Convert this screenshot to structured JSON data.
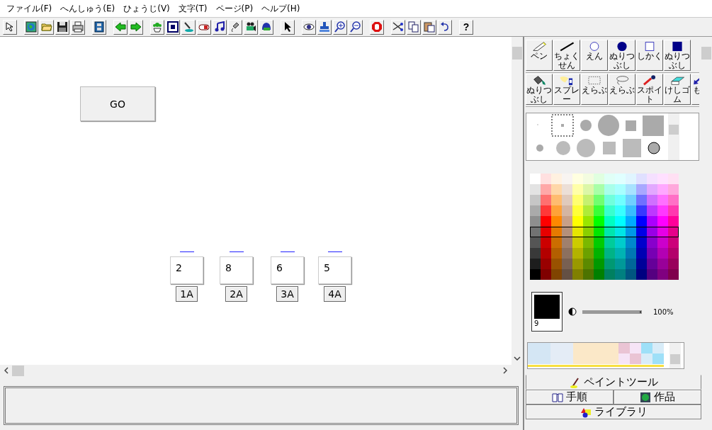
{
  "menu": [
    "ファイル(F)",
    "へんしゅう(E)",
    "ひょうじ(V)",
    "文字(T)",
    "ページ(P)",
    "ヘルプ(H)"
  ],
  "toolbar": [
    [
      {
        "kind": "pointer"
      }
    ],
    [
      {
        "kind": "globe"
      },
      {
        "kind": "folder"
      },
      {
        "kind": "floppy"
      },
      {
        "kind": "printer"
      }
    ],
    [
      {
        "kind": "film"
      }
    ],
    [
      {
        "kind": "arrow-left"
      },
      {
        "kind": "arrow-right"
      }
    ],
    [
      {
        "kind": "plant"
      },
      {
        "kind": "text-box"
      },
      {
        "kind": "brush"
      },
      {
        "kind": "capsule"
      },
      {
        "kind": "note"
      },
      {
        "kind": "mic"
      },
      {
        "kind": "camera"
      },
      {
        "kind": "helmet"
      }
    ],
    [
      {
        "kind": "cursor"
      }
    ],
    [
      {
        "kind": "eye"
      },
      {
        "kind": "stamp"
      },
      {
        "kind": "zoom-in"
      },
      {
        "kind": "zoom-out"
      }
    ],
    [
      {
        "kind": "stop"
      }
    ],
    [
      {
        "kind": "scissors"
      },
      {
        "kind": "copy"
      },
      {
        "kind": "paste"
      },
      {
        "kind": "undo"
      }
    ],
    [
      {
        "kind": "text",
        "text": "?"
      }
    ]
  ],
  "canvas": {
    "go_button": "GO",
    "cards": [
      {
        "value": "2",
        "label": "1A"
      },
      {
        "value": "8",
        "label": "2A"
      },
      {
        "value": "6",
        "label": "3A"
      },
      {
        "value": "5",
        "label": "4A"
      }
    ]
  },
  "paint_tools": [
    [
      {
        "kind": "pen",
        "label": "ペン"
      },
      {
        "kind": "line",
        "label": "ちょくせん"
      },
      {
        "kind": "circle",
        "label": "えん"
      },
      {
        "kind": "filled-circle",
        "label": "ぬりつぶし"
      },
      {
        "kind": "rect",
        "label": "しかく"
      },
      {
        "kind": "filled-rect",
        "label": "ぬりつぶし"
      }
    ],
    [
      {
        "kind": "bucket",
        "label": "ぬりつぶし"
      },
      {
        "kind": "spray",
        "label": "スプレー"
      },
      {
        "kind": "select-rect",
        "label": "えらぶ"
      },
      {
        "kind": "lasso",
        "label": "えらぶ"
      },
      {
        "kind": "dropper",
        "label": "スポイト"
      },
      {
        "kind": "eraser",
        "label": "けしゴム"
      },
      {
        "kind": "back",
        "label": "も"
      }
    ]
  ],
  "palette": [
    {
      "selected": false
    },
    {
      "selected": false
    },
    {
      "selected": false
    },
    {
      "selected": false
    },
    {
      "selected": false
    },
    {
      "selected": true
    },
    {
      "selected": false
    },
    {
      "selected": false
    },
    {
      "selected": false
    },
    {
      "selected": false
    }
  ],
  "current_color": {
    "color": "#000000",
    "number": "9"
  },
  "opacity": {
    "level": 1,
    "reading": "100%"
  },
  "tabs": [
    {
      "label": "ペイントツール",
      "kind": "paint",
      "selected": true
    },
    {
      "label": "手順",
      "kind": "steps",
      "selected": false
    },
    {
      "label": "作品",
      "kind": "works",
      "selected": false
    },
    {
      "label": "ライブラリ",
      "kind": "library",
      "selected": false
    }
  ]
}
